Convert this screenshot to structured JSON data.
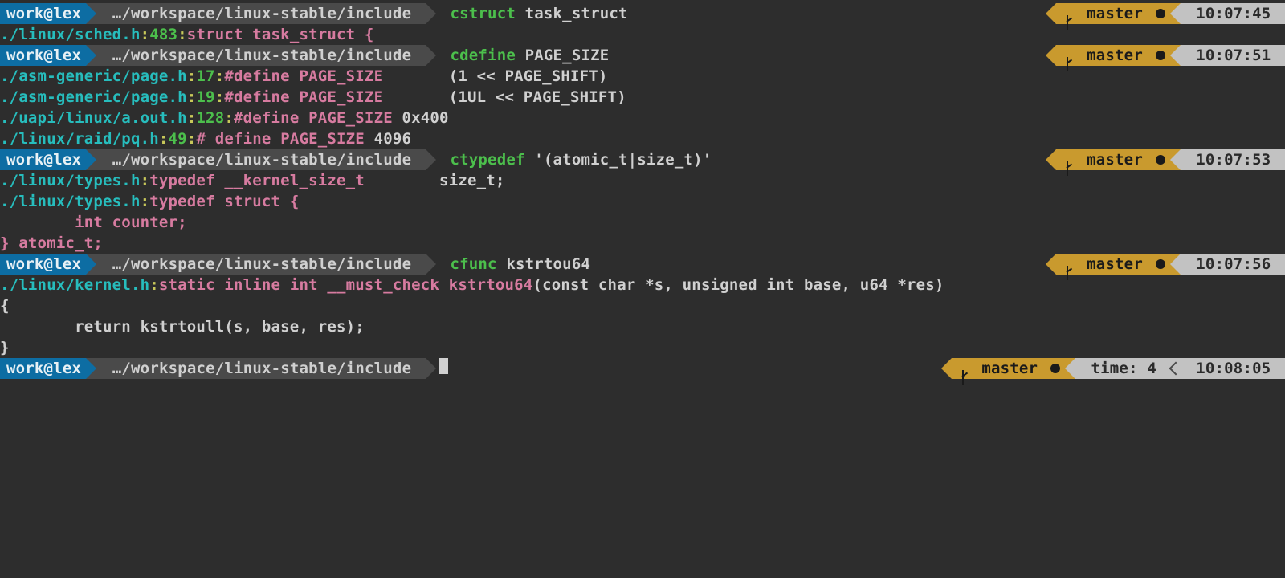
{
  "colors": {
    "blue": "#0d6da3",
    "grey": "#4a4a4a",
    "gold": "#c99a2e",
    "light": "#c2c2c2",
    "cyan": "#27bdbd",
    "green": "#4cbf4c",
    "yellow": "#c8c85a",
    "pink": "#d77ba0"
  },
  "prompt": {
    "user": "work@lex",
    "path": "…/workspace/linux-stable/include",
    "branch": "master"
  },
  "blocks": [
    {
      "cmd": {
        "name": "cstruct",
        "args": "task_struct"
      },
      "time": "10:07:45",
      "output": [
        [
          {
            "c": "cyan",
            "t": "./linux/sched.h"
          },
          {
            "c": "yellow",
            "t": ":"
          },
          {
            "c": "green",
            "t": "483"
          },
          {
            "c": "yellow",
            "t": ":"
          },
          {
            "c": "pink",
            "t": "struct task_struct {"
          }
        ]
      ]
    },
    {
      "cmd": {
        "name": "cdefine",
        "args": "PAGE_SIZE"
      },
      "time": "10:07:51",
      "output": [
        [
          {
            "c": "cyan",
            "t": "./asm-generic/page.h"
          },
          {
            "c": "yellow",
            "t": ":"
          },
          {
            "c": "green",
            "t": "17"
          },
          {
            "c": "yellow",
            "t": ":"
          },
          {
            "c": "pink",
            "t": "#define PAGE_SIZE"
          },
          {
            "c": "grey",
            "t": "       (1 << PAGE_SHIFT)"
          }
        ],
        [
          {
            "c": "cyan",
            "t": "./asm-generic/page.h"
          },
          {
            "c": "yellow",
            "t": ":"
          },
          {
            "c": "green",
            "t": "19"
          },
          {
            "c": "yellow",
            "t": ":"
          },
          {
            "c": "pink",
            "t": "#define PAGE_SIZE"
          },
          {
            "c": "grey",
            "t": "       (1UL << PAGE_SHIFT)"
          }
        ],
        [
          {
            "c": "cyan",
            "t": "./uapi/linux/a.out.h"
          },
          {
            "c": "yellow",
            "t": ":"
          },
          {
            "c": "green",
            "t": "128"
          },
          {
            "c": "yellow",
            "t": ":"
          },
          {
            "c": "pink",
            "t": "#define PAGE_SIZE"
          },
          {
            "c": "grey",
            "t": " 0x400"
          }
        ],
        [
          {
            "c": "cyan",
            "t": "./linux/raid/pq.h"
          },
          {
            "c": "yellow",
            "t": ":"
          },
          {
            "c": "green",
            "t": "49"
          },
          {
            "c": "yellow",
            "t": ":"
          },
          {
            "c": "pink",
            "t": "# define PAGE_SIZE"
          },
          {
            "c": "grey",
            "t": " 4096"
          }
        ]
      ]
    },
    {
      "cmd": {
        "name": "ctypedef",
        "args": "'(atomic_t|size_t)'"
      },
      "time": "10:07:53",
      "output": [
        [
          {
            "c": "cyan",
            "t": "./linux/types.h"
          },
          {
            "c": "yellow",
            "t": ":"
          },
          {
            "c": "pink",
            "t": "typedef __kernel_size_t"
          },
          {
            "c": "grey",
            "t": "        size_t;"
          }
        ],
        [
          {
            "c": "cyan",
            "t": "./linux/types.h"
          },
          {
            "c": "yellow",
            "t": ":"
          },
          {
            "c": "pink",
            "t": "typedef struct {"
          }
        ],
        [
          {
            "c": "pink",
            "t": "        int counter;"
          }
        ],
        [
          {
            "c": "pink",
            "t": "} atomic_t;"
          }
        ]
      ]
    },
    {
      "cmd": {
        "name": "cfunc",
        "args": "kstrtou64"
      },
      "time": "10:07:56",
      "output": [
        [
          {
            "c": "cyan",
            "t": "./linux/kernel.h"
          },
          {
            "c": "yellow",
            "t": ":"
          },
          {
            "c": "pink",
            "t": "static inline int __must_check kstrtou64"
          },
          {
            "c": "grey",
            "t": "(const char *s, unsigned int base, u64 *res)"
          }
        ],
        [
          {
            "c": "grey",
            "t": "{"
          }
        ],
        [
          {
            "c": "grey",
            "t": "        return kstrtoull(s, base, res);"
          }
        ],
        [
          {
            "c": "grey",
            "t": "}"
          }
        ]
      ]
    }
  ],
  "final": {
    "time": "10:08:05",
    "extra": "time: 4"
  }
}
